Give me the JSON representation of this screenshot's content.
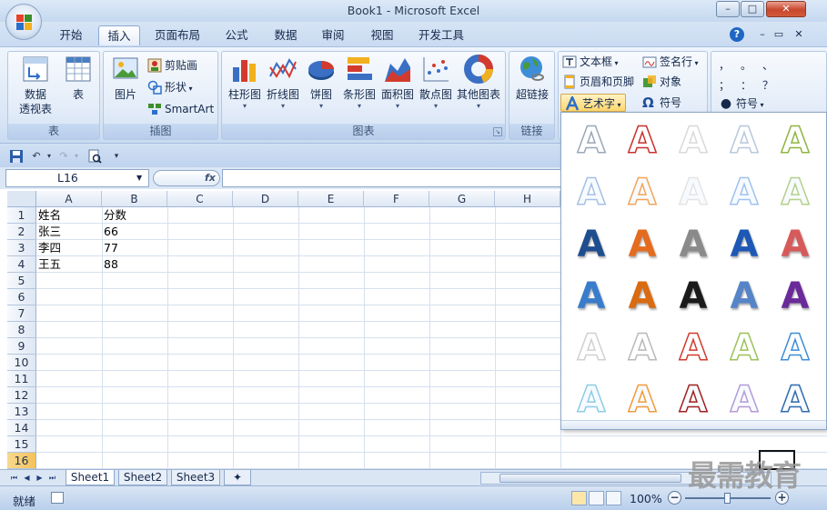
{
  "window": {
    "title": "Book1 - Microsoft Excel",
    "minimize": "–",
    "maximize": "□",
    "close": "✕"
  },
  "tabs": [
    {
      "label": "开始"
    },
    {
      "label": "插入",
      "active": true
    },
    {
      "label": "页面布局"
    },
    {
      "label": "公式"
    },
    {
      "label": "数据"
    },
    {
      "label": "审阅"
    },
    {
      "label": "视图"
    },
    {
      "label": "开发工具"
    }
  ],
  "tabrow_controls": {
    "help": "?",
    "restore": "▭",
    "close": "✕"
  },
  "ribbon": {
    "tables": {
      "label": "表",
      "pivot_line1": "数据",
      "pivot_line2": "透视表",
      "table": "表"
    },
    "illustrations": {
      "label": "插图",
      "picture": "图片",
      "clipart": "剪贴画",
      "shapes": "形状",
      "smartart": "SmartArt"
    },
    "charts": {
      "label": "图表",
      "items": [
        "柱形图",
        "折线图",
        "饼图",
        "条形图",
        "面积图",
        "散点图",
        "其他图表"
      ]
    },
    "links": {
      "label": "链接",
      "hyperlink": "超链接"
    },
    "text": {
      "textbox": "文本框",
      "header_footer": "页眉和页脚",
      "wordart": "艺术字",
      "signature": "签名行",
      "object": "对象",
      "symbol_omega": "符号"
    },
    "special_symbols": {
      "symbol": "符号",
      "glyphs": [
        "，",
        "。",
        "、",
        "；",
        "：",
        "？"
      ]
    }
  },
  "qat": {
    "save": "💾",
    "undo": "↶",
    "redo": "↷",
    "print_preview": "🔍",
    "customize": "▾"
  },
  "formula_bar": {
    "name_box": "L16",
    "fx": "fx",
    "value": ""
  },
  "grid": {
    "columns": [
      "A",
      "B",
      "C",
      "D",
      "E",
      "F",
      "G",
      "H"
    ],
    "rows": [
      "1",
      "2",
      "3",
      "4",
      "5",
      "6",
      "7",
      "8",
      "9",
      "10",
      "11",
      "12",
      "13",
      "14",
      "15",
      "16"
    ],
    "active_row": "16",
    "data": [
      [
        "姓名",
        "分数"
      ],
      [
        "张三",
        "66"
      ],
      [
        "李四",
        "77"
      ],
      [
        "王五",
        "88"
      ]
    ]
  },
  "sheets": [
    "Sheet1",
    "Sheet2",
    "Sheet3"
  ],
  "status": {
    "ready": "就绪",
    "zoom": "100%",
    "zoom_minus": "−",
    "zoom_plus": "+"
  },
  "wordart_gallery": {
    "letter": "A",
    "styles": [
      [
        "#9aa7b8",
        "#c8302c",
        "#d9d9d9",
        "#b8c8dc",
        "#8fb53f"
      ],
      [
        "#a7bfe3",
        "#f3a45a",
        "#e4e4e4",
        "#9fc2ef",
        "#b5d08a"
      ],
      [
        "#1f4e8f",
        "#e56b1f",
        "#8a8a8a",
        "#1d58b5",
        "#d75a5a"
      ],
      [
        "#3a7ccc",
        "#d96b11",
        "#1b1b1b",
        "#5585c7",
        "#6a2a9a"
      ],
      [
        "#d0d0d0",
        "#b9b9b9",
        "#d23a2e",
        "#9ac25a",
        "#3d8ed8"
      ],
      [
        "#8ccde6",
        "#f29a3a",
        "#a11f1f",
        "#b39ad8",
        "#2e6ab0"
      ]
    ]
  },
  "watermark": "最需教育"
}
